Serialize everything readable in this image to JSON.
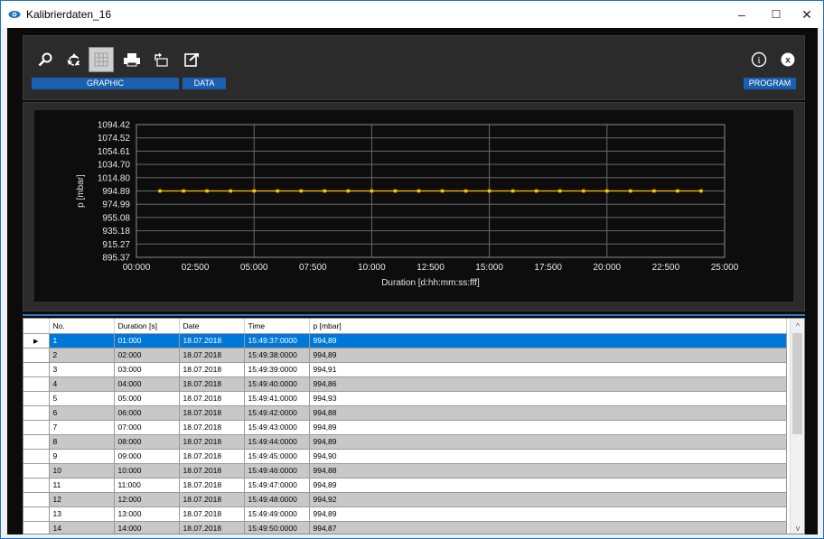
{
  "window": {
    "title": "Kalibrierdaten_16",
    "controls": {
      "minimize": "–",
      "maximize": "☐",
      "close": "✕"
    }
  },
  "toolbar": {
    "buttons": [
      {
        "name": "search-icon",
        "active": false
      },
      {
        "name": "recycle-icon",
        "active": false
      },
      {
        "name": "grid-icon",
        "active": true
      },
      {
        "name": "printer-icon",
        "active": false
      },
      {
        "name": "export-icon",
        "active": false
      },
      {
        "name": "edit-icon",
        "active": false
      }
    ],
    "group_graphic": "GRAPHIC",
    "group_data": "DATA",
    "group_program": "PROGRAM",
    "info_glyph": "i",
    "close_glyph": "x"
  },
  "chart_data": {
    "type": "line",
    "ylabel": "p [mbar]",
    "xlabel": "Duration [d:hh:mm:ss:fff]",
    "y_ticks": [
      "1094.42",
      "1074.52",
      "1054.61",
      "1034.70",
      "1014.80",
      "994.89",
      "974.99",
      "955.08",
      "935.18",
      "915.27",
      "895.37"
    ],
    "x_ticks": [
      "00:000",
      "02:500",
      "05:000",
      "07:500",
      "10:000",
      "12:500",
      "15:000",
      "17:500",
      "20:000",
      "22:500",
      "25:000"
    ],
    "ylim": [
      895.37,
      1094.42
    ],
    "xlim": [
      0,
      25
    ],
    "series": [
      {
        "x": [
          1,
          2,
          3,
          4,
          5,
          6,
          7,
          8,
          9,
          10,
          11,
          12,
          13,
          14,
          15,
          16,
          17,
          18,
          19,
          20,
          21,
          22,
          23,
          24
        ],
        "values": [
          994.89,
          994.89,
          994.91,
          994.86,
          994.93,
          994.88,
          994.89,
          994.89,
          994.9,
          994.88,
          994.89,
          994.92,
          994.89,
          994.87,
          994.89,
          994.89,
          994.89,
          994.89,
          994.89,
          994.89,
          994.89,
          994.89,
          994.89,
          994.89
        ],
        "color": "#ffc000"
      }
    ],
    "grid": true
  },
  "table": {
    "columns": [
      "No.",
      "Duration [s]",
      "Date",
      "Time",
      "p [mbar]"
    ],
    "rows": [
      [
        "1",
        "01:000",
        "18.07.2018",
        "15:49:37:0000",
        "994,89"
      ],
      [
        "2",
        "02:000",
        "18.07.2018",
        "15:49:38:0000",
        "994,89"
      ],
      [
        "3",
        "03:000",
        "18.07.2018",
        "15:49:39:0000",
        "994,91"
      ],
      [
        "4",
        "04:000",
        "18.07.2018",
        "15:49:40:0000",
        "994,86"
      ],
      [
        "5",
        "05:000",
        "18.07.2018",
        "15:49:41:0000",
        "994,93"
      ],
      [
        "6",
        "06:000",
        "18.07.2018",
        "15:49:42:0000",
        "994,88"
      ],
      [
        "7",
        "07:000",
        "18.07.2018",
        "15:49:43:0000",
        "994,89"
      ],
      [
        "8",
        "08:000",
        "18.07.2018",
        "15:49:44:0000",
        "994,89"
      ],
      [
        "9",
        "09:000",
        "18.07.2018",
        "15:49:45:0000",
        "994,90"
      ],
      [
        "10",
        "10:000",
        "18.07.2018",
        "15:49:46:0000",
        "994,88"
      ],
      [
        "11",
        "11:000",
        "18.07.2018",
        "15:49:47:0000",
        "994,89"
      ],
      [
        "12",
        "12:000",
        "18.07.2018",
        "15:49:48:0000",
        "994,92"
      ],
      [
        "13",
        "13:000",
        "18.07.2018",
        "15:49:49:0000",
        "994,89"
      ],
      [
        "14",
        "14:000",
        "18.07.2018",
        "15:49:50:0000",
        "994,87"
      ]
    ],
    "selected_row": 0,
    "row_marker": "▶",
    "scroll_up": "^",
    "scroll_down": "v"
  },
  "colors": {
    "accent": "#1a5fb0",
    "selection": "#0078d7",
    "series": "#ffc000"
  }
}
